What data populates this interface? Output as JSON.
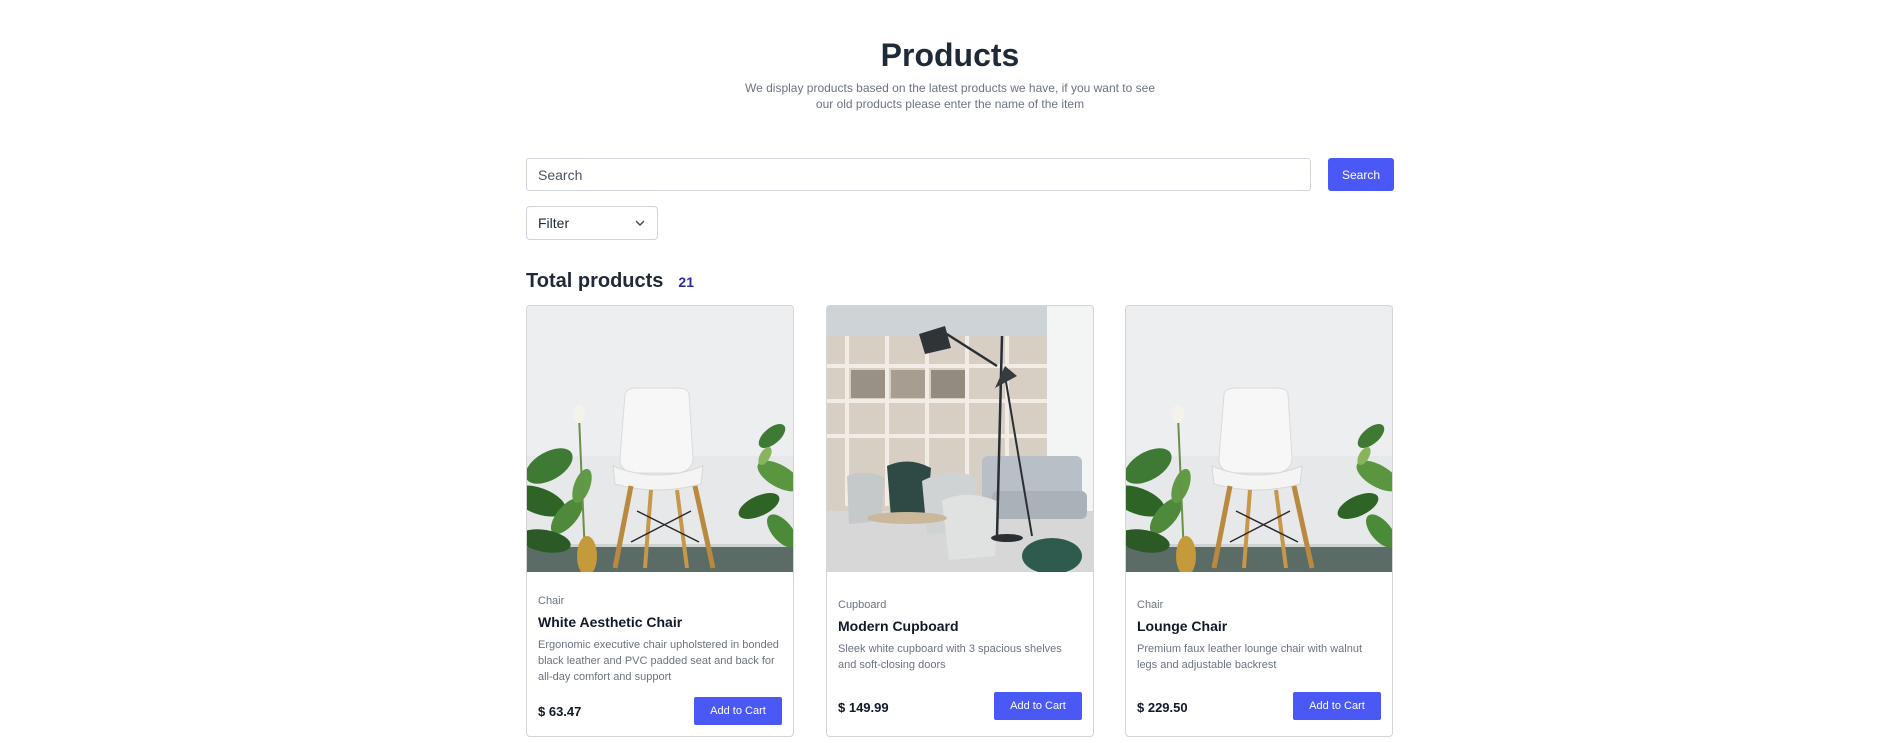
{
  "header": {
    "title": "Products",
    "subtitle": "We display products based on the latest products we have, if you want to see our old products please enter the name of the item"
  },
  "search": {
    "placeholder": "Search",
    "value": "",
    "button_label": "Search"
  },
  "filter": {
    "label": "Filter",
    "icon": "chevron-down-icon"
  },
  "summary": {
    "label": "Total products",
    "count": "21"
  },
  "products": [
    {
      "category": "Chair",
      "name": "White Aesthetic Chair",
      "description": "Ergonomic executive chair upholstered in bonded black leather and PVC padded seat and back for all-day comfort and support",
      "price": "$ 63.47",
      "cart_label": "Add to Cart",
      "image": "white-chair-photo"
    },
    {
      "category": "Cupboard",
      "name": "Modern Cupboard",
      "description": "Sleek white cupboard with 3 spacious shelves and soft-closing doors",
      "price": "$ 149.99",
      "cart_label": "Add to Cart",
      "image": "modern-interior-photo"
    },
    {
      "category": "Chair",
      "name": "Lounge Chair",
      "description": "Premium faux leather lounge chair with walnut legs and adjustable backrest",
      "price": "$ 229.50",
      "cart_label": "Add to Cart",
      "image": "white-chair-photo"
    }
  ],
  "colors": {
    "accent": "#4a58f5",
    "count_text": "#2c2e9c"
  }
}
